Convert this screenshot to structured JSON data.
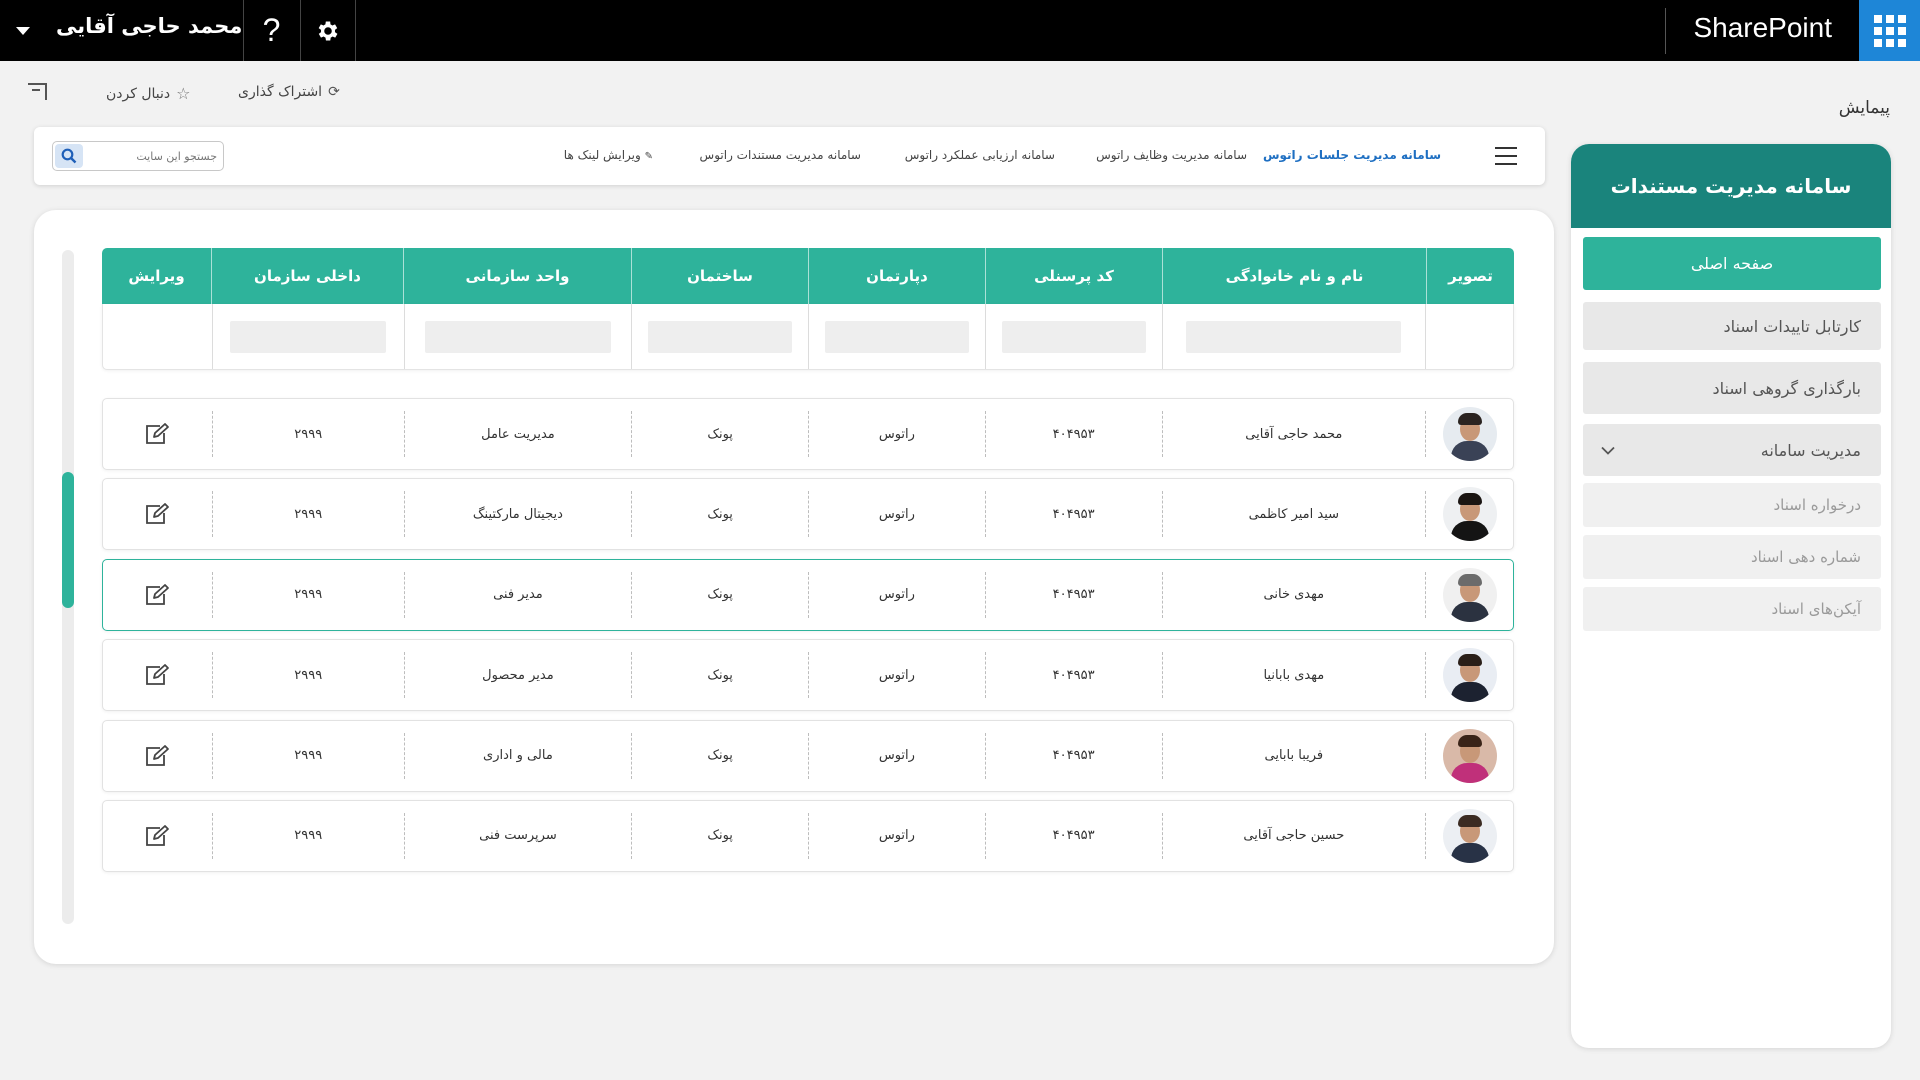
{
  "topbar": {
    "app_title": "SharePoint",
    "user_name": "محمد حاجی آقایی",
    "help_label": "?"
  },
  "actions": {
    "share": "اشتراک گذاری",
    "follow": "دنبال کردن"
  },
  "breadcrumb": "پیمایش",
  "nav": {
    "title": "سامانه مدیریت مستندات",
    "items": [
      {
        "label": "صفحه اصلی"
      },
      {
        "label": "کارتابل تاییدات اسناد"
      },
      {
        "label": "بارگذاری گروهی اسناد"
      },
      {
        "label": "مدیریت سامانه"
      },
      {
        "label": "درخواره اسناد"
      },
      {
        "label": "شماره دهی اسناد"
      },
      {
        "label": "آیکن‌های اسناد"
      }
    ]
  },
  "linkbar": {
    "links": [
      {
        "label": "سامانه مدیریت جلسات راتوس"
      },
      {
        "label": "سامانه مدیریت وظایف راتوس"
      },
      {
        "label": "سامانه ارزیابی عملکرد راتوس"
      },
      {
        "label": "سامانه مدیریت مستندات راتوس"
      },
      {
        "label": "ویرایش لینک ها"
      }
    ],
    "search_placeholder": "جستجو این سایت"
  },
  "table": {
    "headers": [
      "تصویر",
      "نام و نام خانوادگی",
      "کد پرسنلی",
      "دپارتمان",
      "ساختمان",
      "واحد سازمانی",
      "داخلی سازمان",
      "ویرایش"
    ],
    "rows": [
      {
        "name": "محمد حاجی آقایی",
        "code": "۴۰۴۹۵۳",
        "dept": "راتوس",
        "bldg": "پونک",
        "unit": "مدیریت عامل",
        "internal": "۲۹۹۹"
      },
      {
        "name": "سید امیر کاظمی",
        "code": "۴۰۴۹۵۳",
        "dept": "راتوس",
        "bldg": "پونک",
        "unit": "دیجیتال مارکتینگ",
        "internal": "۲۹۹۹"
      },
      {
        "name": "مهدی خانی",
        "code": "۴۰۴۹۵۳",
        "dept": "راتوس",
        "bldg": "پونک",
        "unit": "مدیر فنی",
        "internal": "۲۹۹۹"
      },
      {
        "name": "مهدی بابانیا",
        "code": "۴۰۴۹۵۳",
        "dept": "راتوس",
        "bldg": "پونک",
        "unit": "مدیر محصول",
        "internal": "۲۹۹۹"
      },
      {
        "name": "فریبا بابایی",
        "code": "۴۰۴۹۵۳",
        "dept": "راتوس",
        "bldg": "پونک",
        "unit": "مالی و اداری",
        "internal": "۲۹۹۹"
      },
      {
        "name": "حسین حاجی آقایی",
        "code": "۴۰۴۹۵۳",
        "dept": "راتوس",
        "bldg": "پونک",
        "unit": "سرپرست فنی",
        "internal": "۲۹۹۹"
      }
    ]
  },
  "colors": {
    "accent": "#2eb39b",
    "nav_header": "#1a847c",
    "topbar": "#000000",
    "waffle": "#1e86d7",
    "active_link": "#1e6fc2"
  }
}
